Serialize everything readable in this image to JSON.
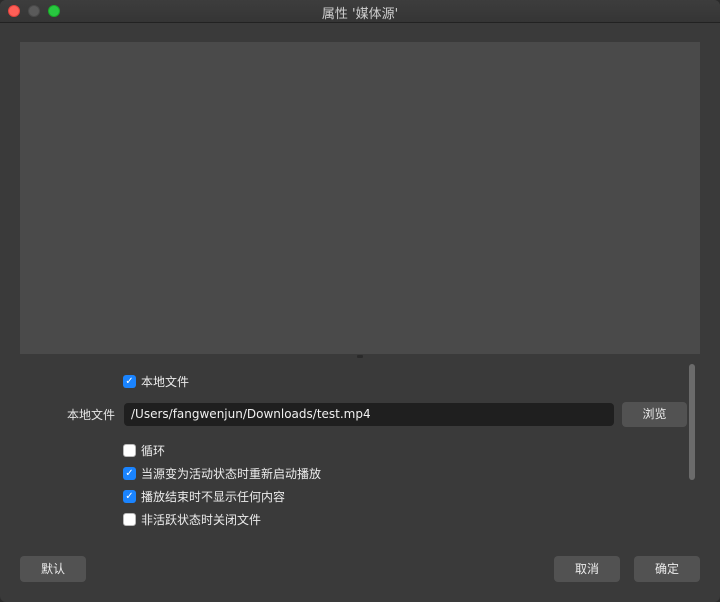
{
  "window": {
    "title": "属性 '媒体源'"
  },
  "settings": {
    "local_file_checkbox": {
      "label": "本地文件",
      "checked": true
    },
    "local_file_field": {
      "label": "本地文件",
      "value": "/Users/fangwenjun/Downloads/test.mp4"
    },
    "browse_label": "浏览",
    "loop": {
      "label": "循环",
      "checked": false
    },
    "restart_on_activate": {
      "label": "当源变为活动状态时重新启动播放",
      "checked": true
    },
    "hide_when_done": {
      "label": "播放结束时不显示任何内容",
      "checked": true
    },
    "close_when_inactive": {
      "label": "非活跃状态时关闭文件",
      "checked": false
    }
  },
  "footer": {
    "defaults_label": "默认",
    "cancel_label": "取消",
    "ok_label": "确定"
  },
  "colors": {
    "accent": "#1a84ff",
    "background": "#3a3a3a",
    "preview": "#4a4a4a"
  }
}
